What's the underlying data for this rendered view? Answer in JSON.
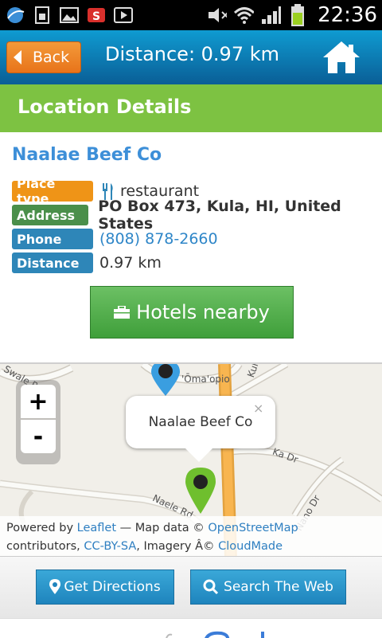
{
  "status_bar": {
    "time": "22:36",
    "icons_left": [
      "browser-icon",
      "sim-icon",
      "image-icon",
      "app-s-icon",
      "play-store-icon"
    ],
    "icons_right": [
      "mute-icon",
      "wifi-icon",
      "signal-icon",
      "battery-icon"
    ]
  },
  "header": {
    "back_label": "Back",
    "title": "Distance: 0.97 km",
    "home_icon": "home-icon"
  },
  "section": {
    "title": "Location Details"
  },
  "place": {
    "name": "Naalae Beef Co",
    "details": [
      {
        "label": "Place type",
        "value": "restaurant"
      },
      {
        "label": "Address",
        "value": "PO Box 473, Kula, HI, United States"
      },
      {
        "label": "Phone",
        "value": "(808) 878-2660"
      },
      {
        "label": "Distance",
        "value": "0.97 km"
      }
    ]
  },
  "hotels_button": {
    "label": "Hotels nearby"
  },
  "map": {
    "zoom_in": "+",
    "zoom_out": "-",
    "popup_text": "Naalae Beef Co",
    "popup_close": "×",
    "labels": [
      "'Ōma'opio",
      "Kula",
      "Ka Dr",
      "Nano Dr",
      "Naele Rd",
      "Swale Rd"
    ],
    "attribution": {
      "powered_by": "Powered by ",
      "leaflet": "Leaflet",
      "map_data": " — Map data © ",
      "osm": "OpenStreetMap",
      "contributors": "contributors, ",
      "license": "CC-BY-SA",
      "imagery": ", Imagery Â© ",
      "cloudmade": "CloudMade"
    }
  },
  "bottom_buttons": {
    "directions": "Get Directions",
    "search": "Search The Web"
  },
  "colors": {
    "header": "#0a5e96",
    "section": "#7dc242",
    "back": "#e8741a",
    "hotels": "#4fae48",
    "bottom_button": "#1e84bd"
  }
}
